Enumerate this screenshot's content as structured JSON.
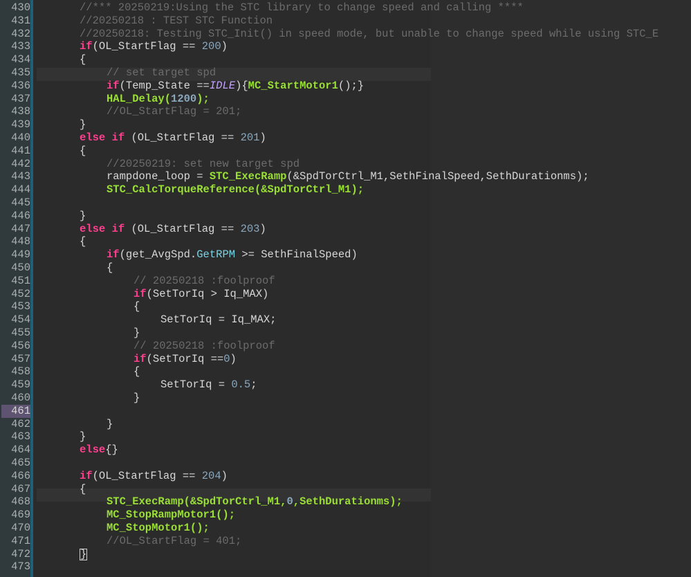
{
  "lines": [
    {
      "num": "430",
      "text": "//*** 20250219:Using the STC library to change speed and calling ****"
    },
    {
      "num": "431",
      "text": "//20250218 : TEST STC Function"
    },
    {
      "num": "432",
      "text": "//20250218: Testing STC_Init() in speed mode, but unable to change speed while using STC_E"
    },
    {
      "num": "433",
      "text": "if(OL_StartFlag == 200)"
    },
    {
      "num": "434",
      "text": "{"
    },
    {
      "num": "435",
      "text": "// set target spd"
    },
    {
      "num": "436",
      "text": "if(Temp_State ==IDLE){MC_StartMotor1();}"
    },
    {
      "num": "437",
      "text": "HAL_Delay(1200);"
    },
    {
      "num": "438",
      "text": "//OL_StartFlag = 201;"
    },
    {
      "num": "439",
      "text": "}"
    },
    {
      "num": "440",
      "text": "else if (OL_StartFlag == 201)"
    },
    {
      "num": "441",
      "text": "{"
    },
    {
      "num": "442",
      "text": "//20250219: set new target spd"
    },
    {
      "num": "443",
      "text": "rampdone_loop = STC_ExecRamp(&SpdTorCtrl_M1,SethFinalSpeed,SethDurationms);"
    },
    {
      "num": "444",
      "text": "STC_CalcTorqueReference(&SpdTorCtrl_M1);"
    },
    {
      "num": "445",
      "text": ""
    },
    {
      "num": "446",
      "text": "}"
    },
    {
      "num": "447",
      "text": "else if (OL_StartFlag == 203)"
    },
    {
      "num": "448",
      "text": "{"
    },
    {
      "num": "449",
      "text": "if(get_AvgSpd.GetRPM >= SethFinalSpeed)"
    },
    {
      "num": "450",
      "text": "{"
    },
    {
      "num": "451",
      "text": "// 20250218 :foolproof"
    },
    {
      "num": "452",
      "text": "if(SetTorIq > Iq_MAX)"
    },
    {
      "num": "453",
      "text": "{"
    },
    {
      "num": "454",
      "text": "SetTorIq = Iq_MAX;"
    },
    {
      "num": "455",
      "text": "}"
    },
    {
      "num": "456",
      "text": "// 20250218 :foolproof"
    },
    {
      "num": "457",
      "text": "if(SetTorIq ==0)"
    },
    {
      "num": "458",
      "text": "{"
    },
    {
      "num": "459",
      "text": "SetTorIq = 0.5;"
    },
    {
      "num": "460",
      "text": "}"
    },
    {
      "num": "461",
      "text": ""
    },
    {
      "num": "462",
      "text": "}"
    },
    {
      "num": "463",
      "text": "}"
    },
    {
      "num": "464",
      "text": "else{}"
    },
    {
      "num": "465",
      "text": ""
    },
    {
      "num": "466",
      "text": "if(OL_StartFlag == 204)"
    },
    {
      "num": "467",
      "text": "{"
    },
    {
      "num": "468",
      "text": "STC_ExecRamp(&SpdTorCtrl_M1,0,SethDurationms);"
    },
    {
      "num": "469",
      "text": "MC_StopRampMotor1();"
    },
    {
      "num": "470",
      "text": "MC_StopMotor1();"
    },
    {
      "num": "471",
      "text": "//OL_StartFlag = 401;"
    },
    {
      "num": "472",
      "text": "}"
    },
    {
      "num": "473",
      "text": ""
    }
  ],
  "active_line": "461",
  "colors": {
    "keyword": "#ff3f8e",
    "function": "#9adf35",
    "number": "#8aa8be",
    "comment": "#6c6c6c",
    "member": "#7ad3e3",
    "constant": "#c6a2ff",
    "gutter_accent": "#1f5f78"
  }
}
